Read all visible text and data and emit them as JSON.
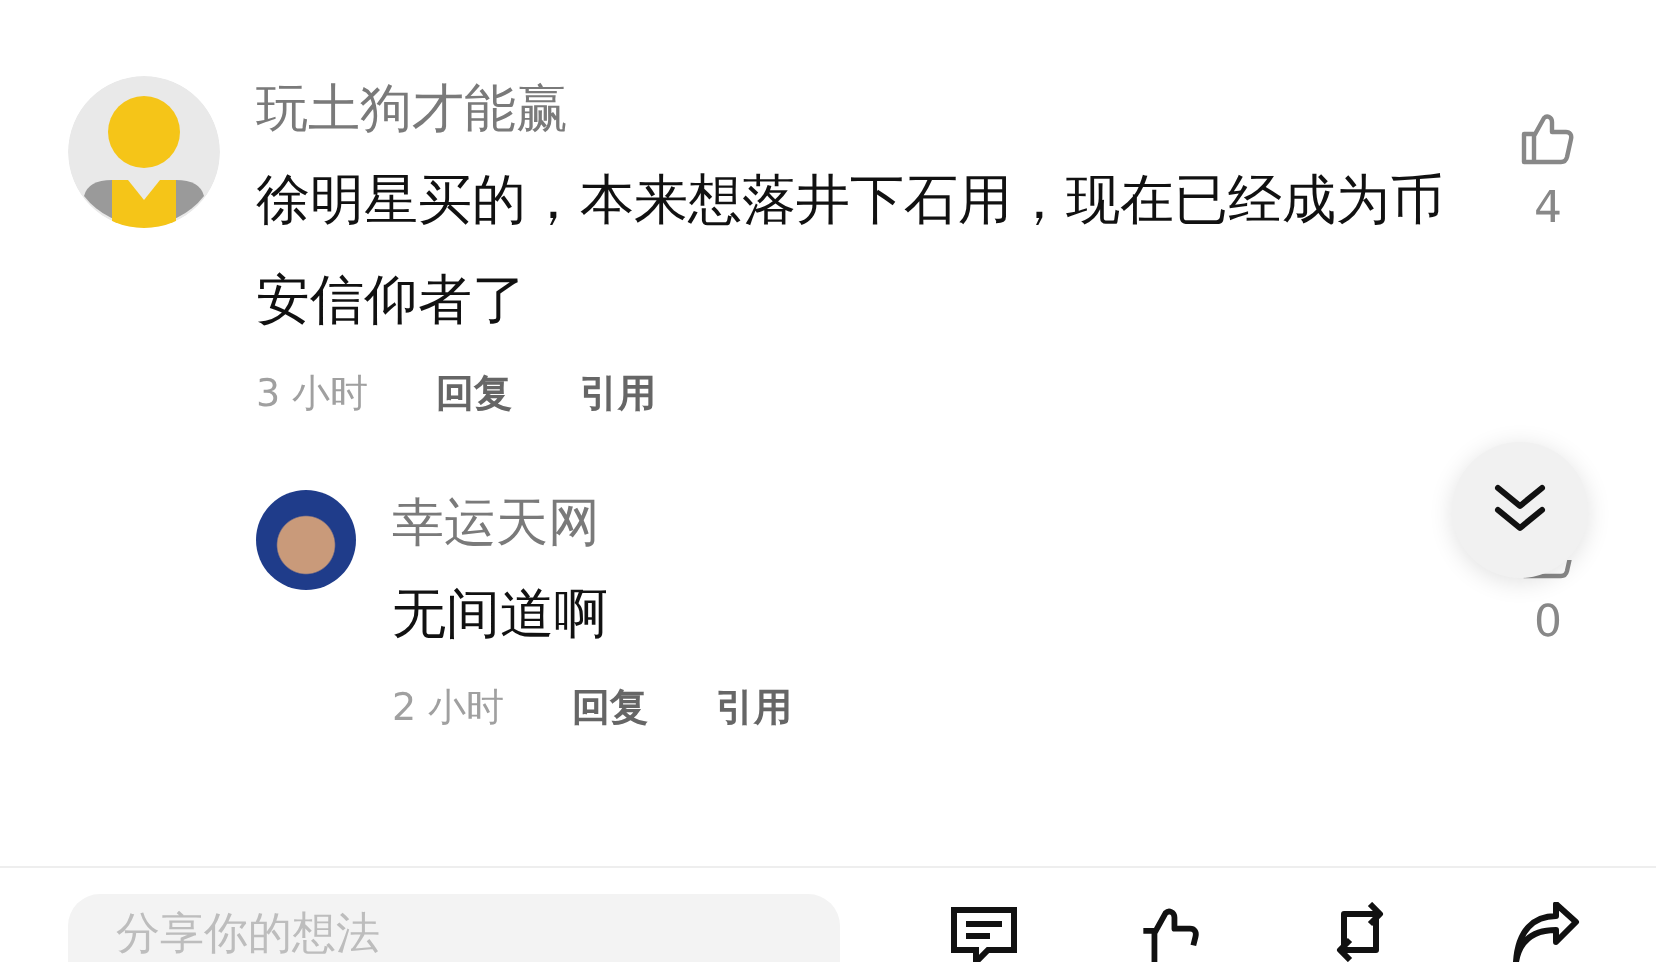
{
  "comments": [
    {
      "author": "玩土狗才能赢",
      "avatar": {
        "kind": "default"
      },
      "text": "徐明星买的，本来想落井下石用，现在已经成为币安信仰者了",
      "time": "3 小时",
      "actions": [
        "回复",
        "引用"
      ],
      "likes": "4",
      "replies": [
        {
          "author": "幸运天网",
          "avatar": {
            "kind": "photo"
          },
          "text": "无间道啊",
          "time": "2 小时",
          "actions": [
            "回复",
            "引用"
          ],
          "likes": "0"
        }
      ]
    }
  ],
  "composer": {
    "placeholder": "分享你的想法"
  }
}
